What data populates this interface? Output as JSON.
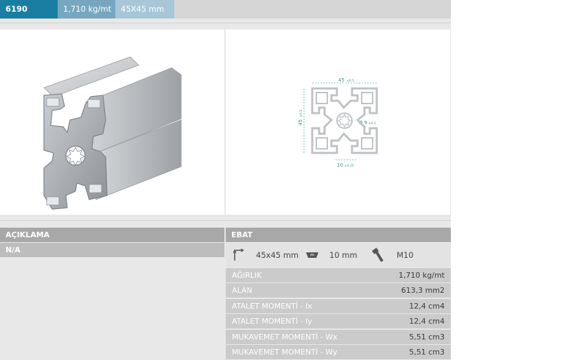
{
  "header": {
    "code": "6190",
    "weight": "1,710 kg/mt",
    "size": "45X45 mm"
  },
  "drawing": {
    "width_dim": "45",
    "width_tol": "±0.5",
    "height_dim": "45",
    "height_tol": "±0.5",
    "hole_dim": "Ø 9",
    "hole_tol": "±0.1",
    "slot_dim": "10",
    "slot_tol": "±0.25"
  },
  "description": {
    "label": "AÇIKLAMA",
    "value": "N/A"
  },
  "dimensions": {
    "label": "EBAT",
    "profile_size": "45x45 mm",
    "slot_width": "10 mm",
    "bolt": "M10",
    "icons": [
      "corner-dimension-icon",
      "t-nut-icon",
      "bolt-icon"
    ]
  },
  "properties": [
    {
      "label": "AĞIRLIK",
      "value": "1,710 kg/mt"
    },
    {
      "label": "ALAN",
      "value": "613,3 mm2"
    },
    {
      "label": "ATALET MOMENTİ - Ix",
      "value": "12,4 cm4"
    },
    {
      "label": "ATALET MOMENTİ - Iy",
      "value": "12,4 cm4"
    },
    {
      "label": "MUKAVEMET MOMENTİ - Wx",
      "value": "5,51 cm3"
    },
    {
      "label": "MUKAVEMET MOMENTİ - Wy",
      "value": "5,51 cm3"
    }
  ],
  "colors": {
    "code_bg": "#1a7ea2",
    "weight_bg": "#77a7c0",
    "size_bg": "#a7c7d8",
    "section_head": "#a8a8a8",
    "dimension_line": "#4fb0a6"
  }
}
